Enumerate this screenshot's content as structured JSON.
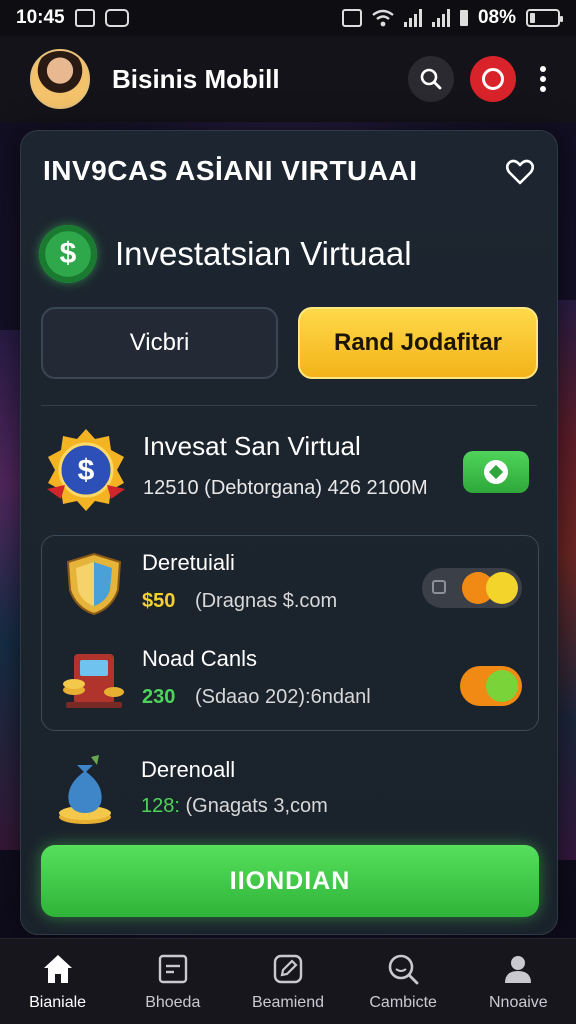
{
  "status_bar": {
    "time": "10:45",
    "battery": "08%"
  },
  "header": {
    "title": "Bisinis Mobill"
  },
  "card": {
    "title": "INV9CAS ASİANI VIRTUAAI",
    "section_title": "Investatsian Virtuaal",
    "tabs": [
      {
        "label": "Vicbri",
        "active": false
      },
      {
        "label": "Rand Jodafitar",
        "active": true
      }
    ],
    "featured": {
      "title": "Invesat San Virtual",
      "subtitle": "12510 (Debtorgana) 426 2100M"
    },
    "items": [
      {
        "title": "Deretuiali",
        "amount": "$50",
        "detail": "(Dragnas $.com",
        "toggle": "on"
      },
      {
        "title": "Noad Canls",
        "amount": "230",
        "detail": "(Sdaao 202):6ndanl",
        "toggle": "on"
      }
    ],
    "item3": {
      "title": "Derenoall",
      "amount": "128:",
      "detail": "(Gnagats 3,com"
    },
    "cta_label": "IIONDIAN"
  },
  "bottom_nav": [
    {
      "label": "Bianiale",
      "icon": "home-icon",
      "active": true
    },
    {
      "label": "Bhoeda",
      "icon": "folder-icon",
      "active": false
    },
    {
      "label": "Beamiend",
      "icon": "edit-icon",
      "active": false
    },
    {
      "label": "Cambicte",
      "icon": "search-icon",
      "active": false
    },
    {
      "label": "Nnoaive",
      "icon": "person-icon",
      "active": false
    }
  ],
  "colors": {
    "accent_green": "#3fc84a",
    "accent_yellow": "#f7cf33",
    "record_red": "#d9232b",
    "card_bg": "#1d2630"
  }
}
